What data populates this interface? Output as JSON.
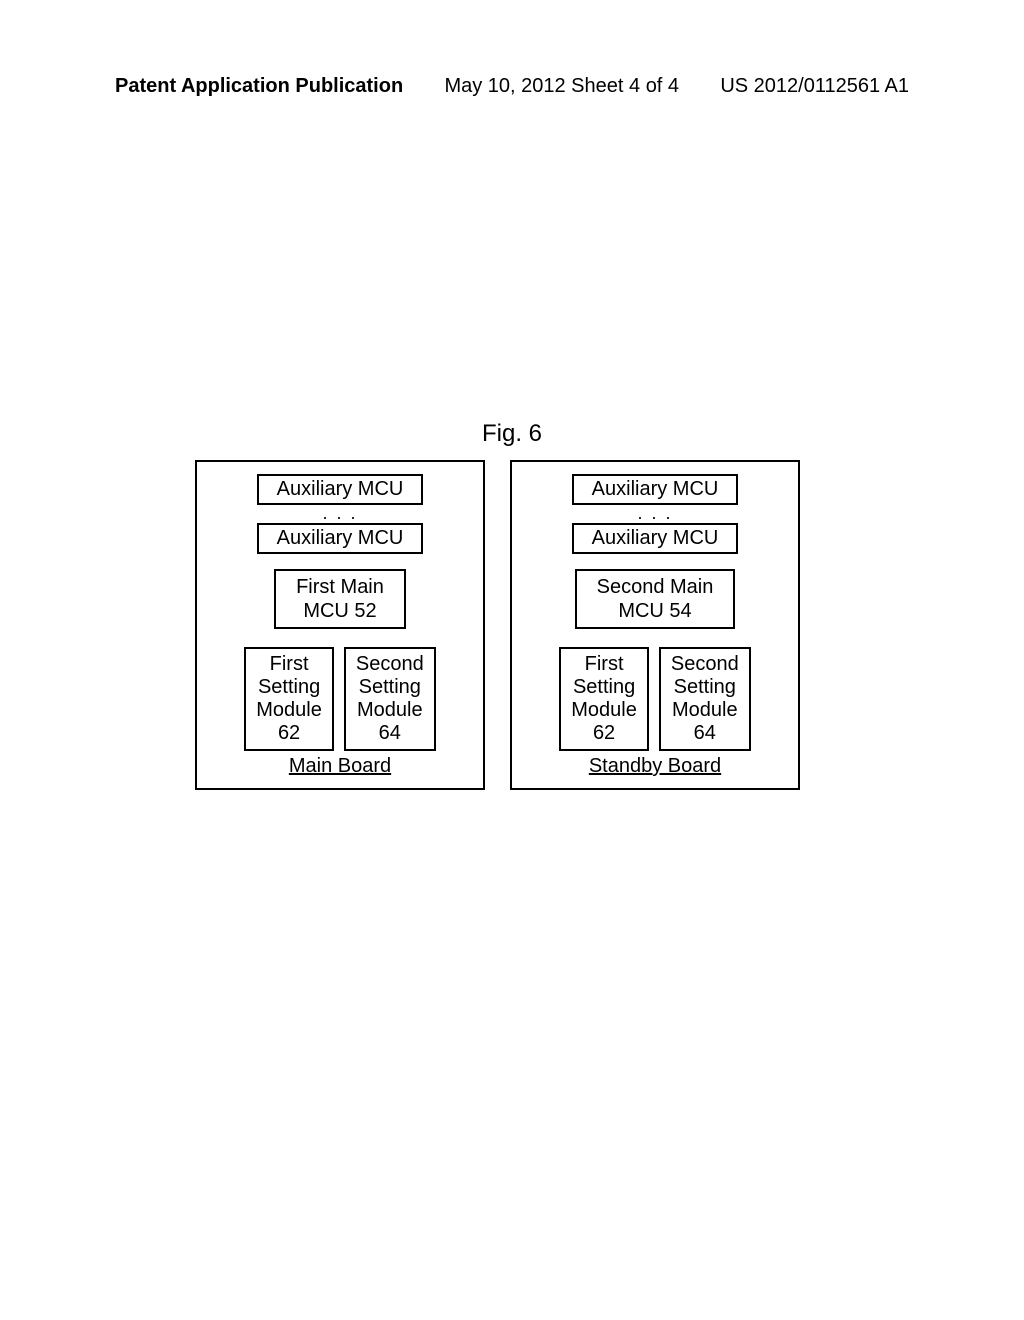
{
  "header": {
    "left": "Patent Application Publication",
    "center": "May 10, 2012  Sheet 4 of 4",
    "right": "US 2012/0112561 A1"
  },
  "figure_label": "Fig. 6",
  "main_board": {
    "aux_mcu_1": "Auxiliary MCU",
    "aux_mcu_2": "Auxiliary MCU",
    "main_mcu_line1": "First Main",
    "main_mcu_line2": "MCU 52",
    "module1_line1": "First",
    "module1_line2": "Setting",
    "module1_line3": "Module",
    "module1_line4": "62",
    "module2_line1": "Second",
    "module2_line2": "Setting",
    "module2_line3": "Module",
    "module2_line4": "64",
    "label": "Main Board"
  },
  "standby_board": {
    "aux_mcu_1": "Auxiliary MCU",
    "aux_mcu_2": "Auxiliary MCU",
    "main_mcu_line1": "Second Main",
    "main_mcu_line2": "MCU 54",
    "module1_line1": "First",
    "module1_line2": "Setting",
    "module1_line3": "Module",
    "module1_line4": "62",
    "module2_line1": "Second",
    "module2_line2": "Setting",
    "module2_line3": "Module",
    "module2_line4": "64",
    "label": "Standby Board"
  }
}
